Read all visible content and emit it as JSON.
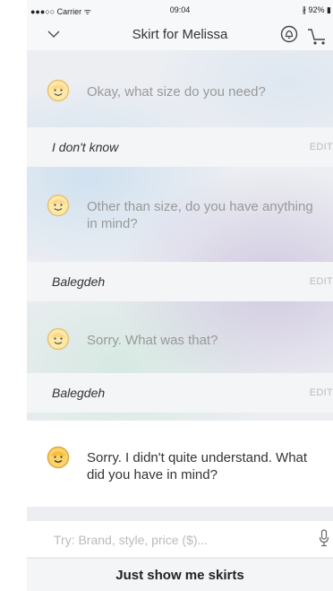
{
  "status": {
    "carrier": "●●●○○ Carrier ᯤ",
    "time": "09:04",
    "battery": "∦ 92% ▮"
  },
  "nav": {
    "title": "Skirt for Melissa"
  },
  "chat": {
    "q1": "Okay, what size do you need?",
    "a1": "I don't know",
    "q2": "Other than size, do you have anything in mind?",
    "a2": "Balegdeh",
    "q3": "Sorry. What was that?",
    "a3": "Balegdeh",
    "q4": "Sorry. I didn't quite understand. What did you have in mind?",
    "edit_label": "EDIT"
  },
  "input": {
    "placeholder": "Try: Brand, style, price ($)...",
    "value": ""
  },
  "action": {
    "label": "Just show me skirts"
  },
  "colors": {
    "face_fill": "#fcd36a",
    "face_stroke": "#e0a63c"
  }
}
